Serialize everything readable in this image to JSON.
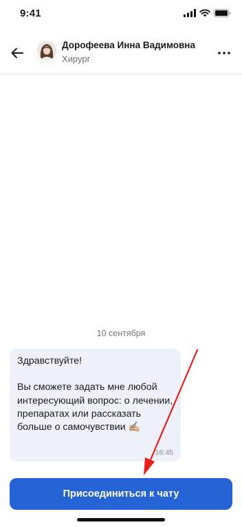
{
  "status_bar": {
    "time": "9:41",
    "icons": [
      "signal-icon",
      "wifi-icon",
      "battery-icon"
    ]
  },
  "header": {
    "back_icon": "arrow-left-icon",
    "doctor_name": "Дорофеева Инна Вадимовна",
    "doctor_role": "Хирург",
    "more_icon": "more-dots-icon"
  },
  "chat": {
    "date": "10 сентября",
    "message": {
      "text": "Здравствуйте!\n\nВы сможете задать мне любой интересующий вопрос: о лечении, препаратах или рассказать больше о самочувствии ✍🏼",
      "time": "16:45"
    }
  },
  "join_button": {
    "label": "Присоединиться к чату",
    "color": "#2562d6"
  },
  "annotation": {
    "color": "#e8201c"
  }
}
